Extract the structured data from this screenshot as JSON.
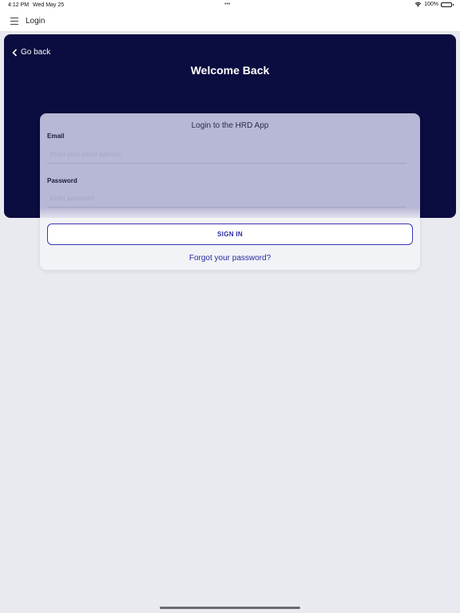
{
  "status_bar": {
    "time": "4:12 PM",
    "date": "Wed May 25",
    "more_dots": "•••",
    "battery_text": "100%",
    "wifi_icon": "wifi-icon",
    "battery_icon": "battery-icon"
  },
  "nav": {
    "title": "Login",
    "menu_icon": "hamburger-menu-icon"
  },
  "hero": {
    "back_label": "Go back",
    "title": "Welcome Back",
    "background": "#0b0c3f"
  },
  "login_card": {
    "title": "Login to the HRD App",
    "email": {
      "label": "Email",
      "value": "",
      "placeholder": "Enter your email address"
    },
    "password": {
      "label": "Password",
      "value": "",
      "placeholder": "Enter password"
    },
    "sign_in_label": "SIGN IN",
    "forgot_label": "Forgot your password?"
  },
  "colors": {
    "accent": "#2a2aa0",
    "card_overlay": "#b7b7d6",
    "page_bg": "#e8eaf0"
  }
}
